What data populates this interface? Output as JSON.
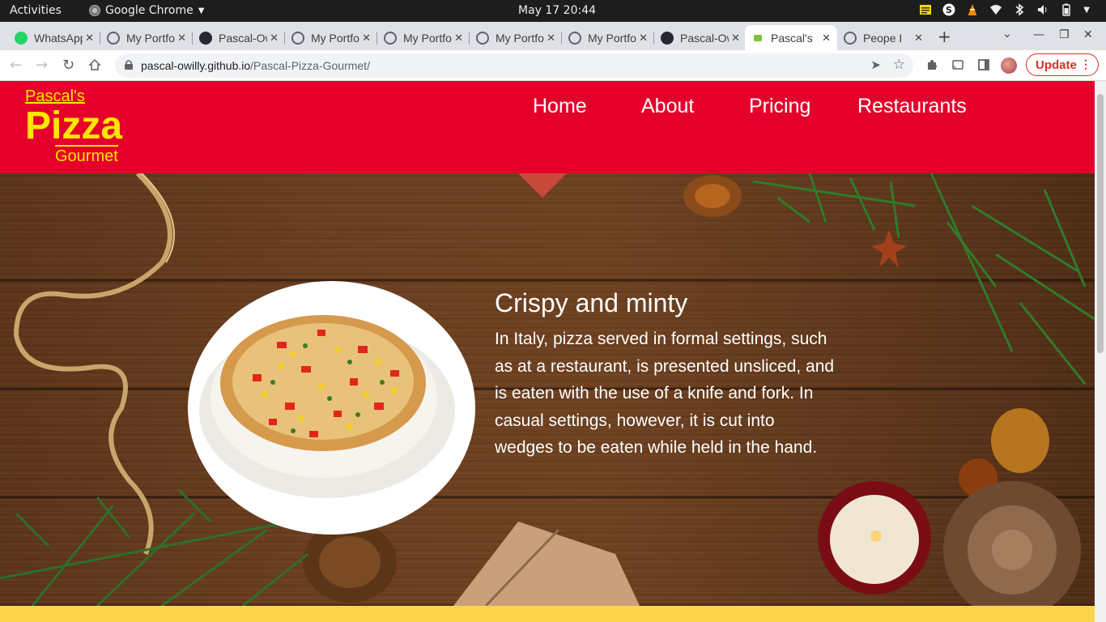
{
  "desktop": {
    "activities": "Activities",
    "app_name": "Google Chrome",
    "clock": "May 17  20:44"
  },
  "browser": {
    "tabs": [
      {
        "title": "WhatsApp",
        "icon": "whatsapp-icon",
        "active": false
      },
      {
        "title": "My Portfolio",
        "icon": "globe-icon",
        "active": false
      },
      {
        "title": "Pascal-Owilly",
        "icon": "github-icon",
        "active": false
      },
      {
        "title": "My Portfolio",
        "icon": "globe-icon",
        "active": false
      },
      {
        "title": "My Portfolio",
        "icon": "globe-icon",
        "active": false
      },
      {
        "title": "My Portfolio",
        "icon": "globe-icon",
        "active": false
      },
      {
        "title": "My Portfolio",
        "icon": "globe-icon",
        "active": false
      },
      {
        "title": "Pascal-Owilly",
        "icon": "github-icon",
        "active": false
      },
      {
        "title": "Pascal's",
        "icon": "leaf-icon",
        "active": true
      },
      {
        "title": "Peope I",
        "icon": "globe-icon",
        "active": false
      }
    ],
    "address": {
      "domain": "pascal-owilly.github.io",
      "path": "/Pascal-Pizza-Gourmet/"
    },
    "update_label": "Update"
  },
  "site": {
    "logo": {
      "pascals": "Pascal's",
      "pizza": "Pizza",
      "gourmet": "Gourmet"
    },
    "nav": [
      "Home",
      "About",
      "Pricing",
      "Restaurants"
    ],
    "hero": {
      "title": "Crispy and minty",
      "text": "In Italy, pizza served in formal settings, such as at a restaurant, is presented unsliced, and is eaten with the use of a knife and fork. In casual settings, however, it is cut into wedges to be eaten while held in the hand."
    },
    "colors": {
      "header_red": "#e4002b",
      "logo_yellow": "#ffe600",
      "band_yellow": "#fdd34a"
    }
  }
}
